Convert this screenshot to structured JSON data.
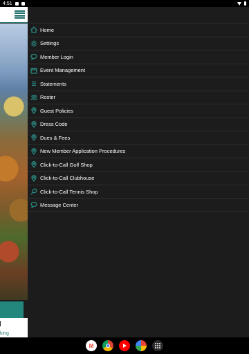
{
  "status_bar": {
    "time": "4:51"
  },
  "drawer": {
    "items": [
      {
        "label": "Home",
        "icon": "home-icon"
      },
      {
        "label": "Settings",
        "icon": "gear-icon"
      },
      {
        "label": "Member Login",
        "icon": "chat-bubble-icon"
      },
      {
        "label": "Event Management",
        "icon": "calendar-icon"
      },
      {
        "label": "Statements",
        "icon": "list-icon"
      },
      {
        "label": "Roster",
        "icon": "people-icon"
      },
      {
        "label": "Guest Policies",
        "icon": "location-pin-icon"
      },
      {
        "label": "Dress Code",
        "icon": "location-pin-icon"
      },
      {
        "label": "Dues & Fees",
        "icon": "location-pin-icon"
      },
      {
        "label": "New Member Application Procedures",
        "icon": "location-pin-icon"
      },
      {
        "label": "Click-to-Call Golf Shop",
        "icon": "location-pin-icon"
      },
      {
        "label": "Click-to-Call Clubhouse",
        "icon": "location-pin-icon"
      },
      {
        "label": "Click-to-Call Tennis Shop",
        "icon": "tennis-racket-icon"
      },
      {
        "label": "Message Center",
        "icon": "chat-bubble-icon"
      }
    ]
  },
  "background_app": {
    "partial_text": "king"
  },
  "colors": {
    "accent": "#2a8a82",
    "drawer_bg": "#1c1c1c",
    "header_teal": "#1f6f6a"
  }
}
